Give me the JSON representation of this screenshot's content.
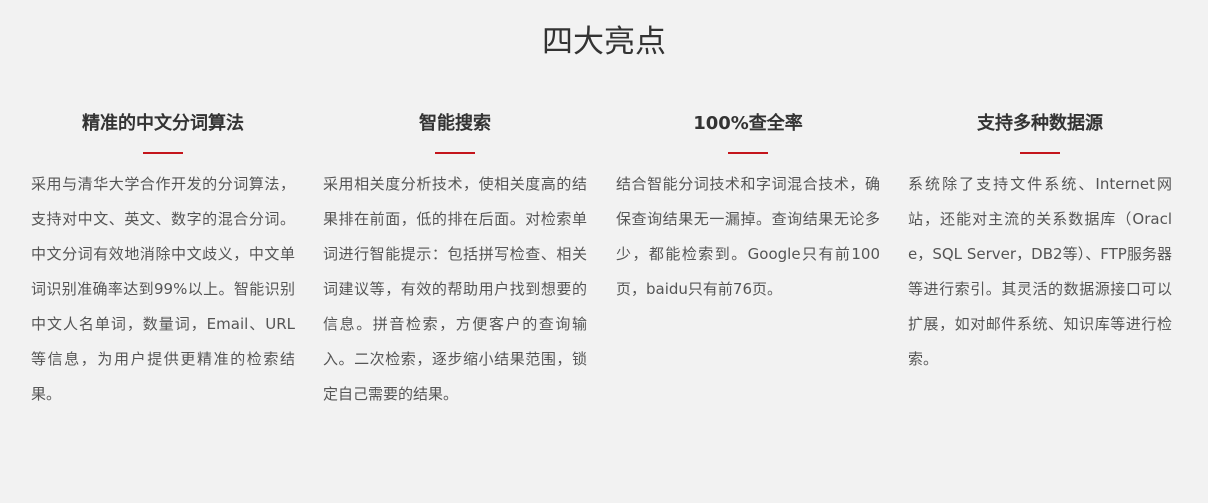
{
  "section": {
    "title": "四大亮点"
  },
  "features": [
    {
      "title": "精准的中文分词算法",
      "description": "采用与清华大学合作开发的分词算法，支持对中文、英文、数字的混合分词。中文分词有效地消除中文歧义，中文单词识别准确率达到99%以上。智能识别中文人名单词，数量词，Email、URL等信息，为用户提供更精准的检索结果。"
    },
    {
      "title": "智能搜索",
      "description": "采用相关度分析技术，使相关度高的结果排在前面，低的排在后面。对检索单词进行智能提示：包括拼写检查、相关词建议等，有效的帮助用户找到想要的信息。拼音检索，方便客户的查询输入。二次检索，逐步缩小结果范围，锁定自己需要的结果。"
    },
    {
      "title": "100%查全率",
      "description": "结合智能分词技术和字词混合技术，确保查询结果无一漏掉。查询结果无论多少，都能检索到。Google只有前100页，baidu只有前76页。"
    },
    {
      "title": "支持多种数据源",
      "description": "系统除了支持文件系统、Internet网站，还能对主流的关系数据库（Oracle，SQL Server，DB2等）、FTP服务器等进行索引。其灵活的数据源接口可以扩展，如对邮件系统、知识库等进行检索。"
    }
  ],
  "colors": {
    "background": "#f2f2f2",
    "accent": "#c4151c",
    "title_text": "#333333",
    "body_text": "#555555"
  }
}
